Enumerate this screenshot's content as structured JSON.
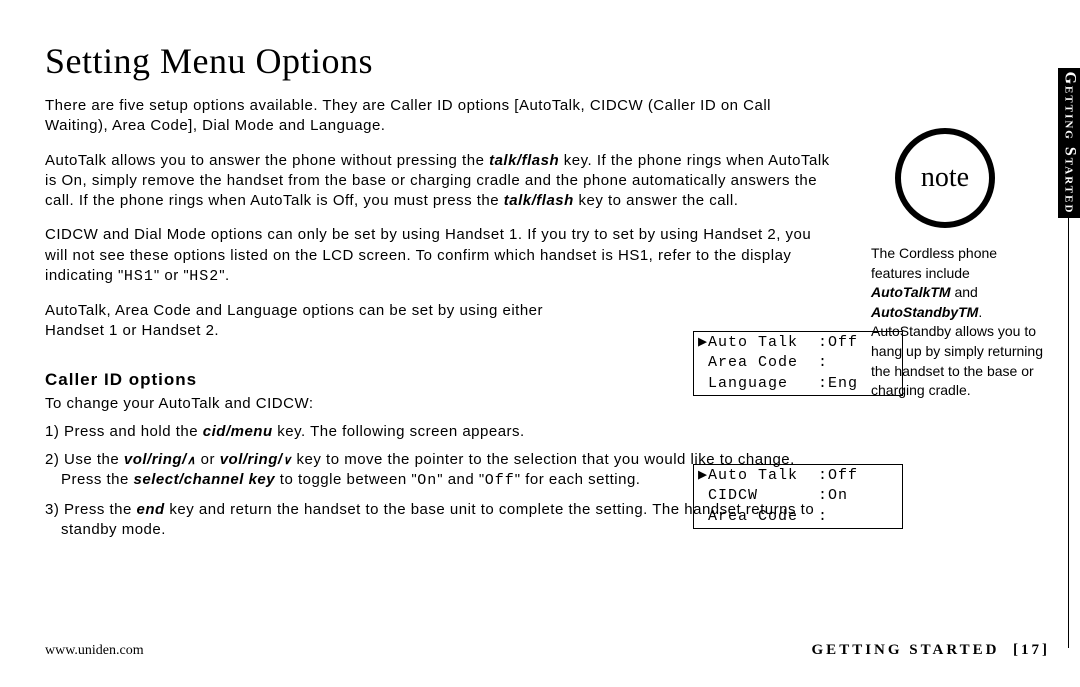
{
  "title": "Setting Menu Options",
  "intro": "There are five setup options available. They are Caller ID options [AutoTalk, CIDCW (Caller ID on Call Waiting), Area Code], Dial Mode and Language.",
  "autotalk_p1a": "AutoTalk allows you to answer the phone without pressing the ",
  "autotalk_key1": "talk/flash",
  "autotalk_p1b": " key. If the phone rings when AutoTalk is On, simply remove the handset from the base or charging cradle and the phone automatically answers the call. If the phone rings when AutoTalk is Off, you must press the ",
  "autotalk_key2": "talk/flash",
  "autotalk_p1c": " key to answer the call.",
  "cidcw_p_a": "CIDCW and Dial Mode options can only be set by using Handset 1. If you try to set by using Handset 2, you will not see these options listed on the LCD screen. To confirm which handset is HS1, refer to the display indicating \"",
  "hs1": "HS1",
  "cidcw_p_b": "\" or \"",
  "hs2": "HS2",
  "cidcw_p_c": "\".",
  "either_p": "AutoTalk, Area Code and Language options can be set by using either Handset 1 or Handset 2.",
  "lcd1": "▶Auto Talk  :Off\n Area Code  :\n Language   :Eng",
  "lcd2": "▶Auto Talk  :Off\n CIDCW      :On\n Area Code  :",
  "subhead": "Caller ID options",
  "change_intro": "To change your AutoTalk and CIDCW:",
  "step1a": "1) Press and hold the ",
  "cidmenu": "cid/menu",
  "step1b": " key. The following screen appears.",
  "step2a": "2) Use the ",
  "volring": "vol/ring/",
  "step2mid": " or ",
  "step2b": " key to move the pointer to the selection that you would like to change.",
  "step2_press_a": "Press the ",
  "selectchannel": "select/channel key",
  "step2_press_b": " to toggle between \"",
  "on": "On",
  "step2_press_c": "\" and \"",
  "off": "Off",
  "step2_press_d": "\" for each setting.",
  "step3a": "3) Press the ",
  "end": "end",
  "step3b": " key and return the handset to the base unit to complete the setting. The handset returns to standby mode.",
  "note_label": "note",
  "note_body_a": "The Cordless phone features include ",
  "autotalk_tm": "AutoTalkTM",
  "note_and": " and ",
  "autostandby_tm": "AutoStandbyTM",
  "note_body_b": ". AutoStandby allows you to hang up by simply returning the handset to the base or charging cradle.",
  "side_tab": "Getting Started",
  "footer_url": "www.uniden.com",
  "footer_section": "GETTING STARTED",
  "footer_page": "[17]"
}
